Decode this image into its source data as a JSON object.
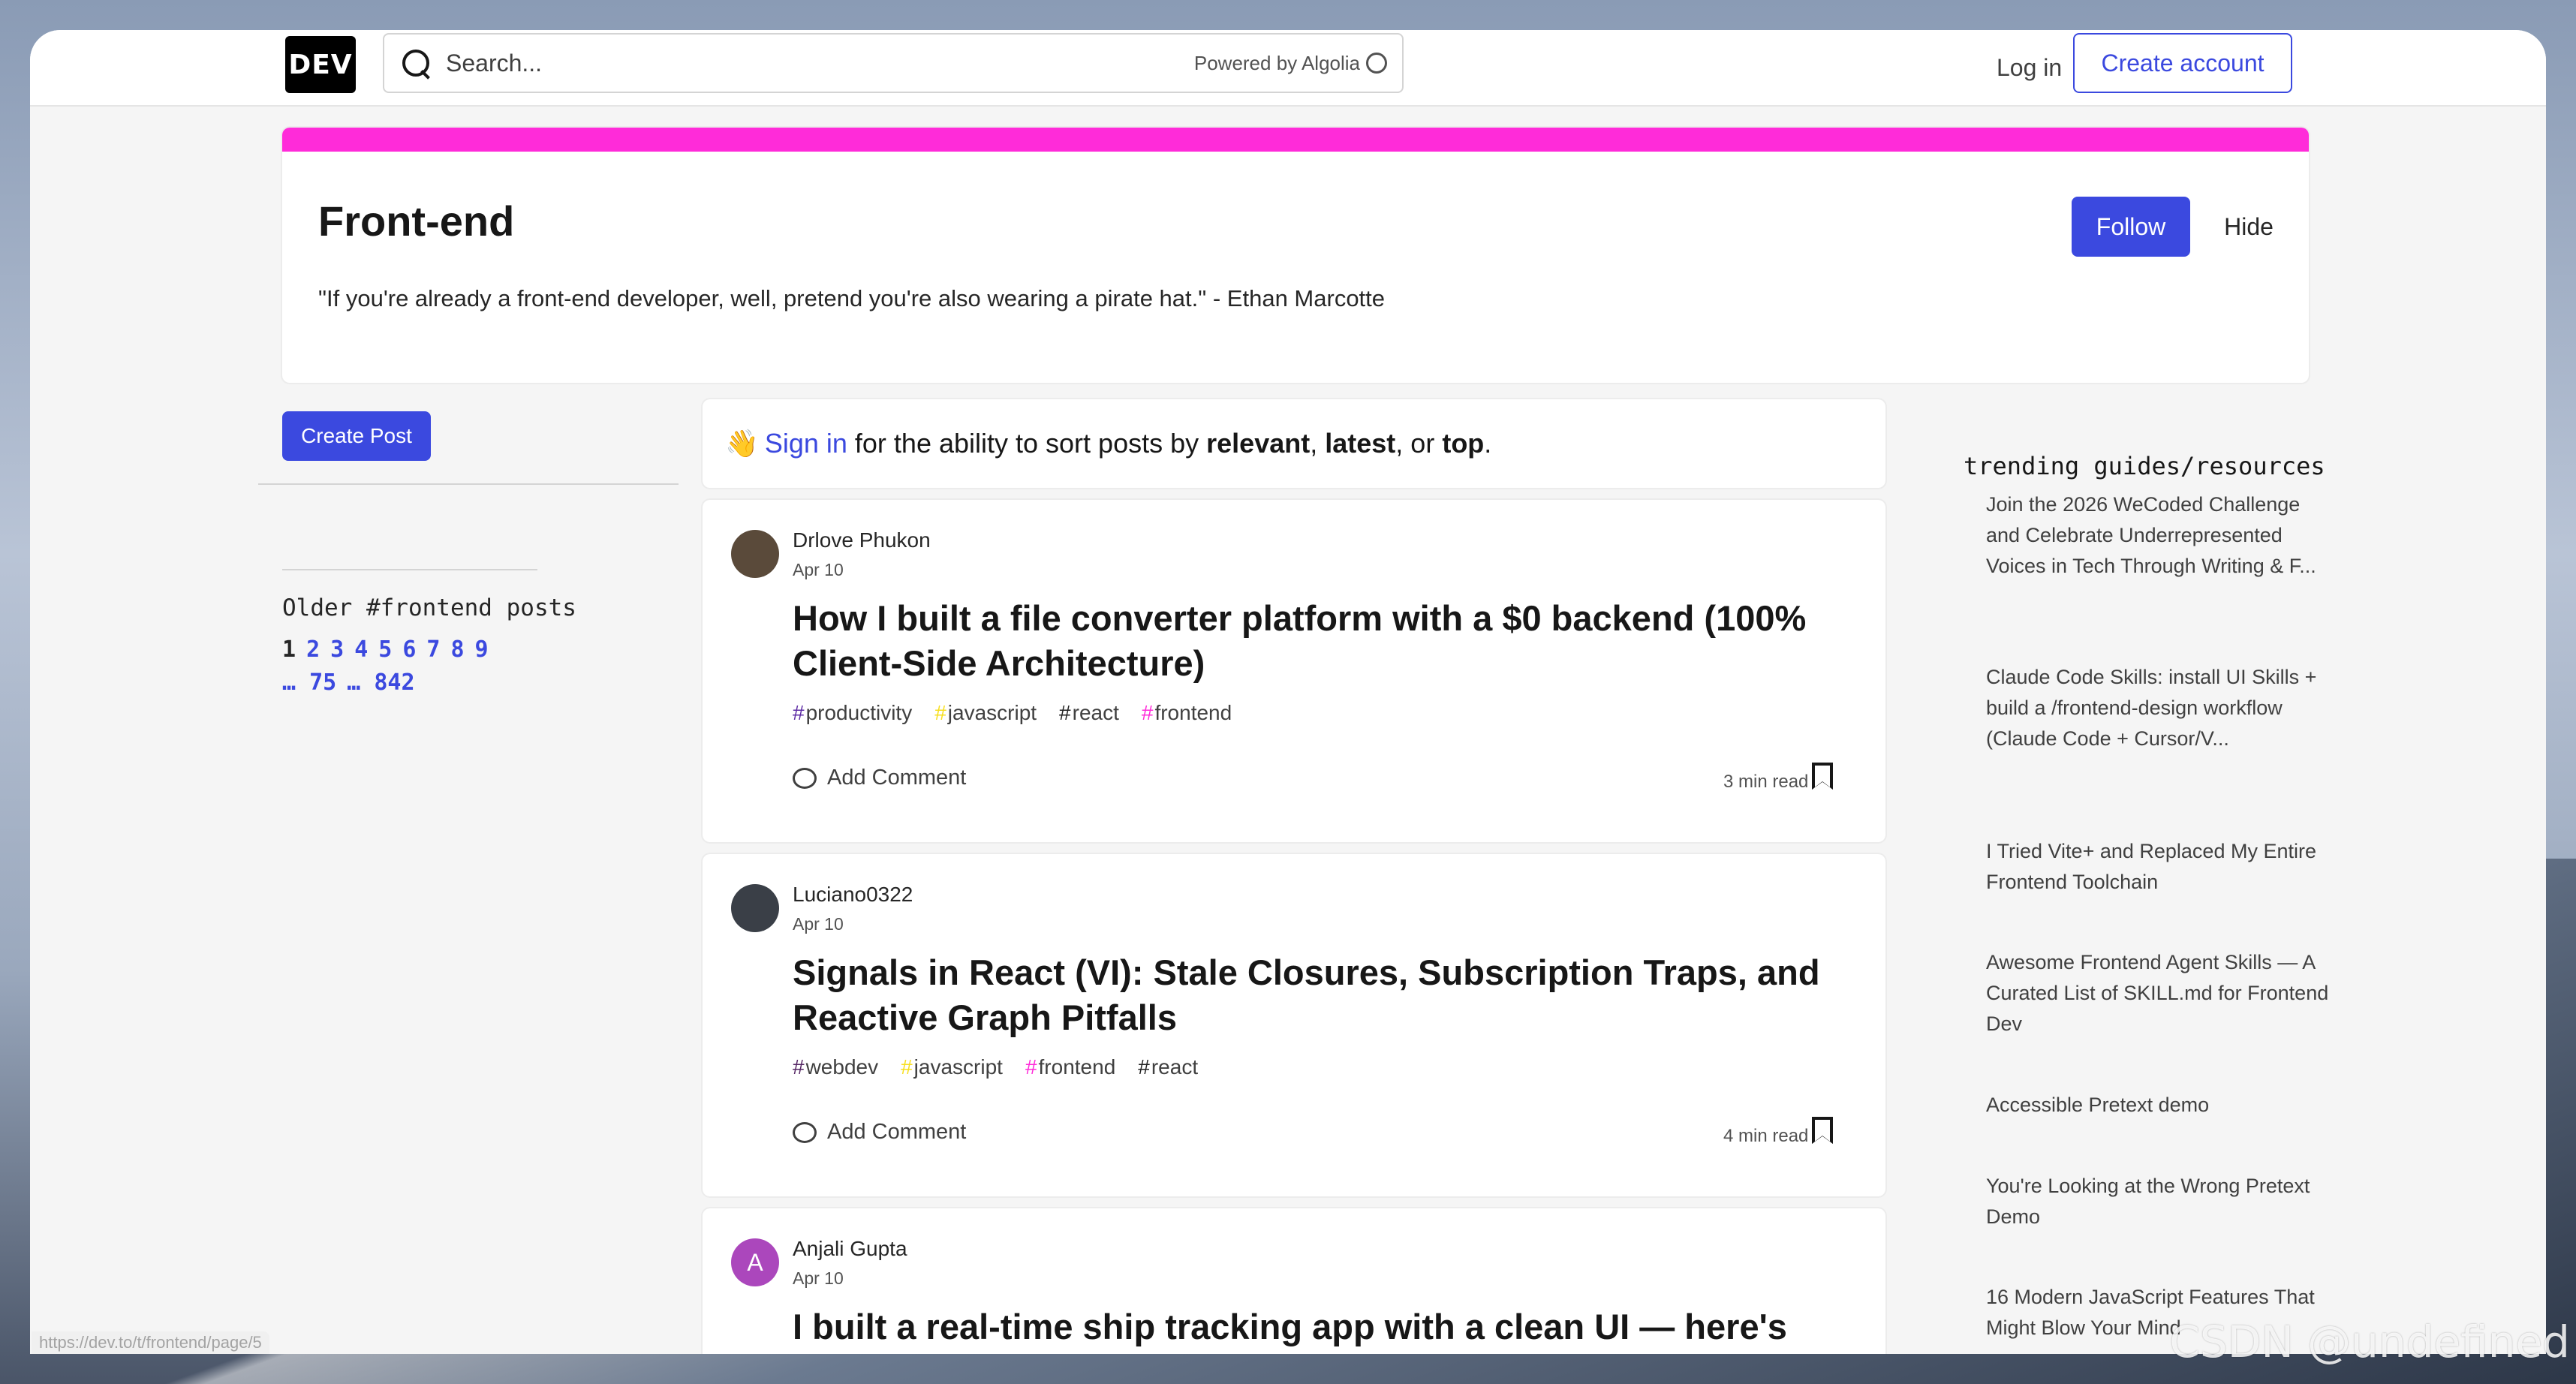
{
  "header": {
    "logo_text": "DEV",
    "search_placeholder": "Search...",
    "search_powered": "Powered by Algolia",
    "login_label": "Log in",
    "create_account_label": "Create account"
  },
  "tag": {
    "title": "Front-end",
    "quote": "\"If you're already a front-end developer, well, pretend you're also wearing a pirate hat.\" - Ethan Marcotte",
    "follow_label": "Follow",
    "hide_label": "Hide",
    "accent_color": "#ff2bd9"
  },
  "left": {
    "create_post_label": "Create Post",
    "older_title": "Older #frontend posts",
    "pages": [
      "1",
      "2",
      "3",
      "4",
      "5",
      "6",
      "7",
      "8",
      "9"
    ],
    "pages_extra": [
      "… 75",
      "… 842"
    ],
    "current_page": "1"
  },
  "feed": {
    "signin": {
      "emoji": "👋",
      "link": "Sign in",
      "text_a": "for the ability to sort posts by",
      "opt1": "relevant",
      "sep1": ",",
      "opt2": "latest",
      "sep2": ", or",
      "opt3": "top",
      "end": "."
    },
    "posts": [
      {
        "author": "Drlove Phukon",
        "date": "Apr 10",
        "title": "How I built a file converter platform with a $0 backend (100% Client-Side Architecture)",
        "tags": [
          {
            "hash": "#",
            "name": "productivity",
            "color": "#5e2ca5"
          },
          {
            "hash": "#",
            "name": "javascript",
            "color": "#f7df1e"
          },
          {
            "hash": "#",
            "name": "react",
            "color": "#222222"
          },
          {
            "hash": "#",
            "name": "frontend",
            "color": "#ff2bd9"
          }
        ],
        "comment_label": "Add Comment",
        "read_time": "3 min read",
        "avatar_letter": "",
        "avatar_color": "#5a4a3a"
      },
      {
        "author": "Luciano0322",
        "date": "Apr 10",
        "title": "Signals in React (VI): Stale Closures, Subscription Traps, and Reactive Graph Pitfalls",
        "tags": [
          {
            "hash": "#",
            "name": "webdev",
            "color": "#562765"
          },
          {
            "hash": "#",
            "name": "javascript",
            "color": "#f7df1e"
          },
          {
            "hash": "#",
            "name": "frontend",
            "color": "#ff2bd9"
          },
          {
            "hash": "#",
            "name": "react",
            "color": "#222222"
          }
        ],
        "comment_label": "Add Comment",
        "read_time": "4 min read",
        "avatar_letter": "",
        "avatar_color": "#3a3f47"
      },
      {
        "author": "Anjali Gupta",
        "date": "Apr 10",
        "title": "I built a real-time ship tracking app with a clean UI — here's",
        "tags": [],
        "comment_label": "",
        "read_time": "",
        "avatar_letter": "A",
        "avatar_color": "#ab47bc"
      }
    ]
  },
  "trending": {
    "title": "trending guides/resources",
    "items": [
      "Join the 2026 WeCoded Challenge and Celebrate Underrepresented Voices in Tech Through Writing & F...",
      "Claude Code Skills: install UI Skills + build a /frontend-design workflow (Claude Code + Cursor/V...",
      "I Tried Vite+ and Replaced My Entire Frontend Toolchain",
      "Awesome Frontend Agent Skills — A Curated List of SKILL.md for Frontend Dev",
      "Accessible Pretext demo",
      "You're Looking at the Wrong Pretext Demo",
      "16 Modern JavaScript Features That Might Blow Your Mind"
    ]
  },
  "status_url": "https://dev.to/t/frontend/page/5",
  "watermark": "CSDN @undefined"
}
